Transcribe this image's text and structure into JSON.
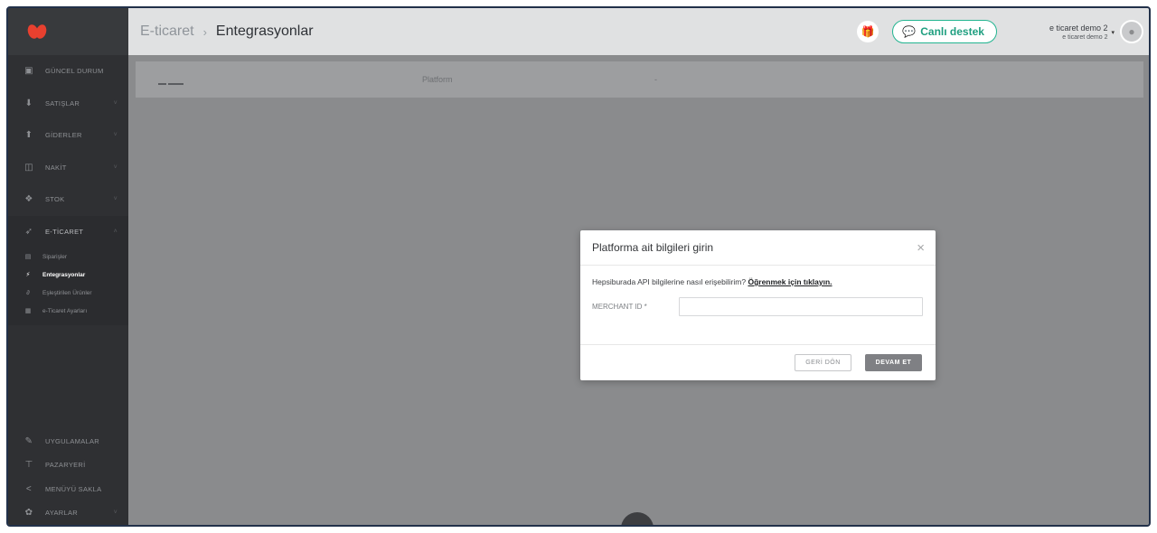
{
  "sidebar": {
    "items": [
      {
        "label": "GÜNCEL DURUM",
        "icon": "dashboard-icon",
        "glyph": "▣",
        "caret": ""
      },
      {
        "label": "SATIŞLAR",
        "icon": "sales-icon",
        "glyph": "⬇",
        "caret": "˅"
      },
      {
        "label": "GİDERLER",
        "icon": "expenses-icon",
        "glyph": "⬆",
        "caret": "˅"
      },
      {
        "label": "NAKİT",
        "icon": "cash-icon",
        "glyph": "◫",
        "caret": "˅"
      },
      {
        "label": "STOK",
        "icon": "stock-icon",
        "glyph": "❖",
        "caret": "˅"
      },
      {
        "label": "E-TİCARET",
        "icon": "rocket-icon",
        "glyph": "➶",
        "caret": "˄"
      }
    ],
    "sub_items": [
      {
        "label": "Siparişler",
        "icon": "orders-icon",
        "glyph": "▤"
      },
      {
        "label": "Entegrasyonlar",
        "icon": "plug-icon",
        "glyph": "⚡"
      },
      {
        "label": "Eşleştirilen Ürünler",
        "icon": "link-icon",
        "glyph": "∂"
      },
      {
        "label": "e-Ticaret Ayarları",
        "icon": "settings-icon",
        "glyph": "▦"
      }
    ],
    "bottom_items": [
      {
        "label": "UYGULAMALAR",
        "icon": "apps-icon",
        "glyph": "✎",
        "caret": ""
      },
      {
        "label": "PAZARYERİ",
        "icon": "cart-icon",
        "glyph": "⊤",
        "caret": ""
      },
      {
        "label": "MENÜYÜ SAKLA",
        "icon": "collapse-icon",
        "glyph": "<",
        "caret": ""
      },
      {
        "label": "AYARLAR",
        "icon": "gear-icon",
        "glyph": "✿",
        "caret": "˅"
      }
    ]
  },
  "header": {
    "breadcrumb_parent": "E-ticaret",
    "breadcrumb_sep": "›",
    "breadcrumb_current": "Entegrasyonlar",
    "gift_glyph": "🎁",
    "support_label": "Canlı destek",
    "support_glyph": "💬",
    "account_name": "e ticaret demo 2",
    "account_sub": "e ticaret demo 2",
    "account_caret": "▾",
    "avatar_glyph": "●"
  },
  "table": {
    "col_platform": "Platform",
    "col_dash": "-"
  },
  "modal": {
    "title": "Platforma ait bilgileri girin",
    "close_glyph": "×",
    "help_text": "Hepsiburada API bilgilerine nasıl erişebilirim?",
    "help_link": "Öğrenmek için tıklayın.",
    "field_label": "MERCHANT ID *",
    "field_value": "",
    "back_label": "GERİ DÖN",
    "next_label": "DEVAM ET"
  },
  "colors": {
    "sidebar_bg": "#2f3033",
    "overlay": "#8a8b8d",
    "brand": "#e8402f",
    "support": "#23b591"
  }
}
